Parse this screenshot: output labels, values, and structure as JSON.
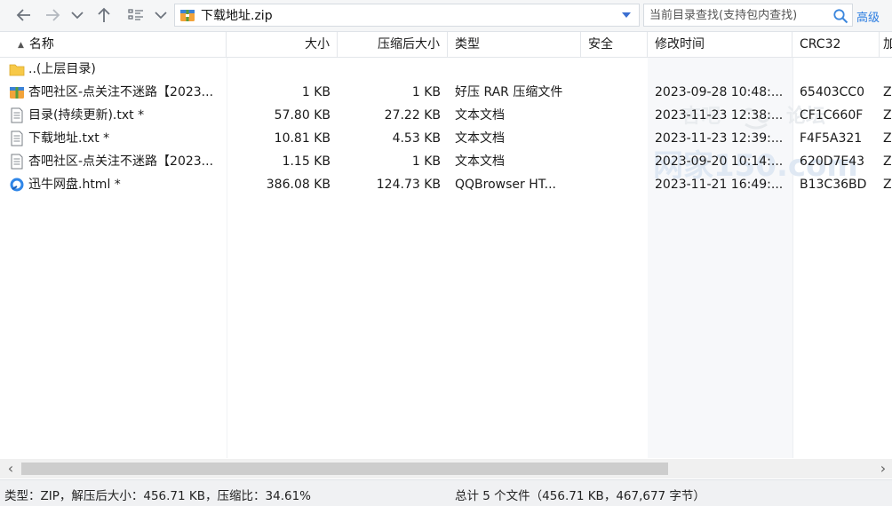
{
  "toolbar": {
    "path": "下载地址.zip",
    "search_placeholder": "当前目录查找(支持包内查找)",
    "advanced_label": "高级"
  },
  "columns": [
    "名称",
    "大小",
    "压缩后大小",
    "类型",
    "安全",
    "修改时间",
    "CRC32",
    "加"
  ],
  "rows": [
    {
      "name": "..(上层目录)",
      "size": "",
      "packed": "",
      "type": "",
      "security": "",
      "modified": "",
      "crc": "",
      "extra": "",
      "icon": "folder-icon"
    },
    {
      "name": "杏吧社区-点关注不迷路【2023...",
      "size": "1 KB",
      "packed": "1 KB",
      "type": "好压 RAR 压缩文件",
      "security": "",
      "modified": "2023-09-28 10:48:...",
      "crc": "65403CC0",
      "extra": "Z",
      "icon": "archive-icon"
    },
    {
      "name": "目录(持续更新).txt *",
      "size": "57.80 KB",
      "packed": "27.22 KB",
      "type": "文本文档",
      "security": "",
      "modified": "2023-11-23 12:38:...",
      "crc": "CF1C660F",
      "extra": "Z",
      "icon": "text-file-icon"
    },
    {
      "name": "下载地址.txt *",
      "size": "10.81 KB",
      "packed": "4.53 KB",
      "type": "文本文档",
      "security": "",
      "modified": "2023-11-23 12:39:...",
      "crc": "F4F5A321",
      "extra": "Z",
      "icon": "text-file-icon"
    },
    {
      "name": "杏吧社区-点关注不迷路【2023...",
      "size": "1.15 KB",
      "packed": "1 KB",
      "type": "文本文档",
      "security": "",
      "modified": "2023-09-20 10:14:...",
      "crc": "620D7E43",
      "extra": "Z",
      "icon": "text-file-icon"
    },
    {
      "name": "迅牛网盘.html *",
      "size": "386.08 KB",
      "packed": "124.73 KB",
      "type": "QQBrowser HT...",
      "security": "",
      "modified": "2023-11-21 16:49:...",
      "crc": "B13C36BD",
      "extra": "Z",
      "icon": "browser-icon"
    }
  ],
  "watermark": {
    "top": "杏吧",
    "top_right": "论坛",
    "bottom": "网家150.com"
  },
  "status": {
    "left": "类型：ZIP，解压后大小：456.71 KB，压缩比：34.61%",
    "right": "总计 5 个文件（456.71 KB，467,677 字节）"
  },
  "colors": {
    "accent": "#2b7de1",
    "zip_icon": "#f2a33a",
    "folder": "#f7c948"
  }
}
